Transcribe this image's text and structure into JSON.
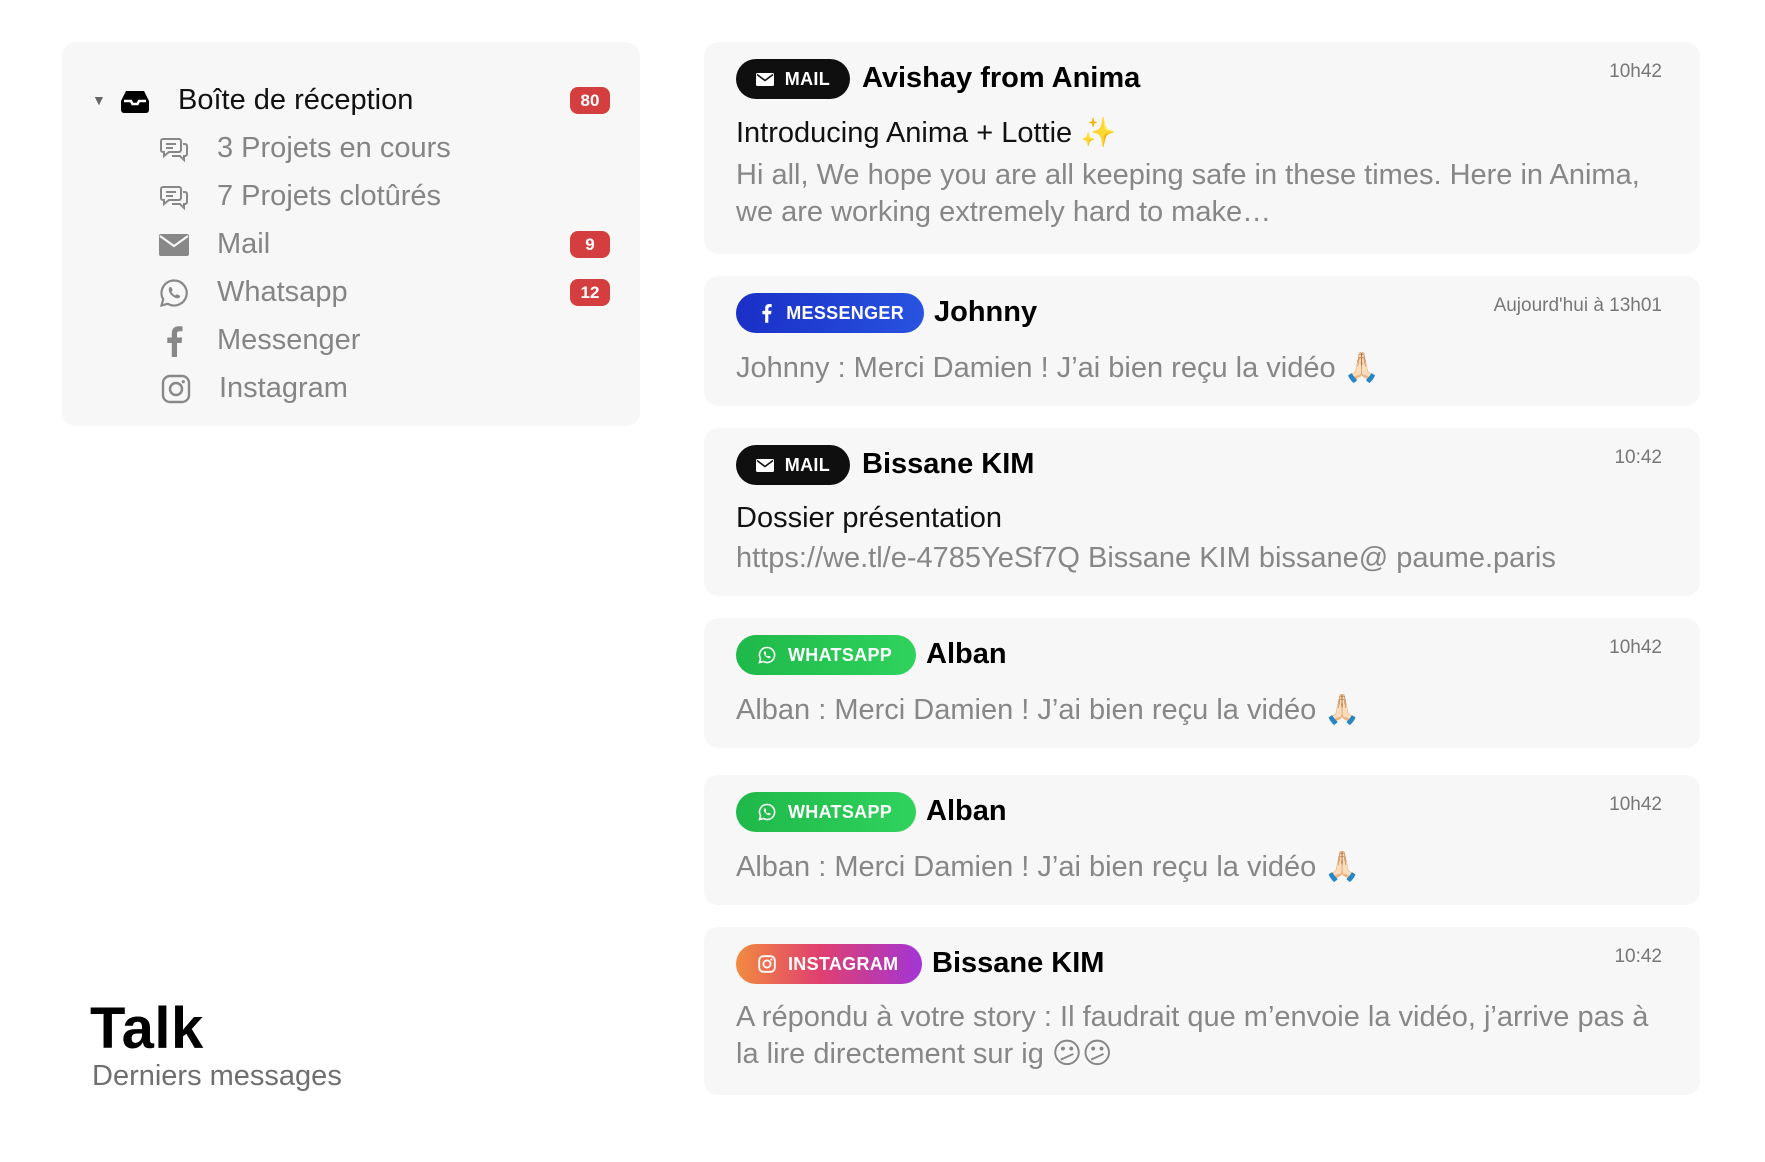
{
  "sidebar": {
    "items": [
      {
        "label": "Boîte de réception",
        "icon": "inbox-icon",
        "badge": "80"
      },
      {
        "label": "3 Projets en cours",
        "icon": "chat-bubbles-icon"
      },
      {
        "label": "7 Projets clotûrés",
        "icon": "chat-bubbles-icon"
      },
      {
        "label": "Mail",
        "icon": "envelope-icon",
        "badge": "9"
      },
      {
        "label": "Whatsapp",
        "icon": "whatsapp-icon",
        "badge": "12"
      },
      {
        "label": "Messenger",
        "icon": "facebook-icon"
      },
      {
        "label": "Instagram",
        "icon": "instagram-icon"
      }
    ]
  },
  "header": {
    "title": "Talk",
    "subtitle": "Derniers messages"
  },
  "colors": {
    "badge": "#d43e3e",
    "mail_pill": "#0f0f0f",
    "messenger_pill": "#1a2fc7",
    "whatsapp_pill": "#1fb84a",
    "instagram_pill_gradient": [
      "#f28a3f",
      "#e0406f",
      "#a235d6"
    ]
  },
  "messages": [
    {
      "channel": "MAIL",
      "sender": "Avishay from Anima",
      "time": "10h42",
      "subject": "Introducing Anima + Lottie ✨",
      "preview": "Hi all, We hope you are all keeping safe in these times. Here in Anima, we are working extremely hard to make…"
    },
    {
      "channel": "MESSENGER",
      "sender": "Johnny",
      "time": "Aujourd'hui à 13h01",
      "preview": "Johnny : Merci Damien ! J’ai bien reçu la vidéo 🙏🏻"
    },
    {
      "channel": "MAIL",
      "sender": "Bissane KIM",
      "time": "10:42",
      "subject": "Dossier présentation",
      "preview": "https://we.tl/e-4785YeSf7Q Bissane KIM bissane@ paume.paris"
    },
    {
      "channel": "WHATSAPP",
      "sender": "Alban",
      "time": "10h42",
      "preview": "Alban : Merci Damien ! J’ai bien reçu la vidéo 🙏🏻"
    },
    {
      "channel": "WHATSAPP",
      "sender": "Alban",
      "time": "10h42",
      "preview": "Alban : Merci Damien ! J’ai bien reçu la vidéo 🙏🏻"
    },
    {
      "channel": "INSTAGRAM",
      "sender": "Bissane KIM",
      "time": "10:42",
      "preview": "A répondu à votre story : Il faudrait que m’envoie la vidéo, j’arrive pas à la lire directement sur ig 😕😕"
    }
  ]
}
